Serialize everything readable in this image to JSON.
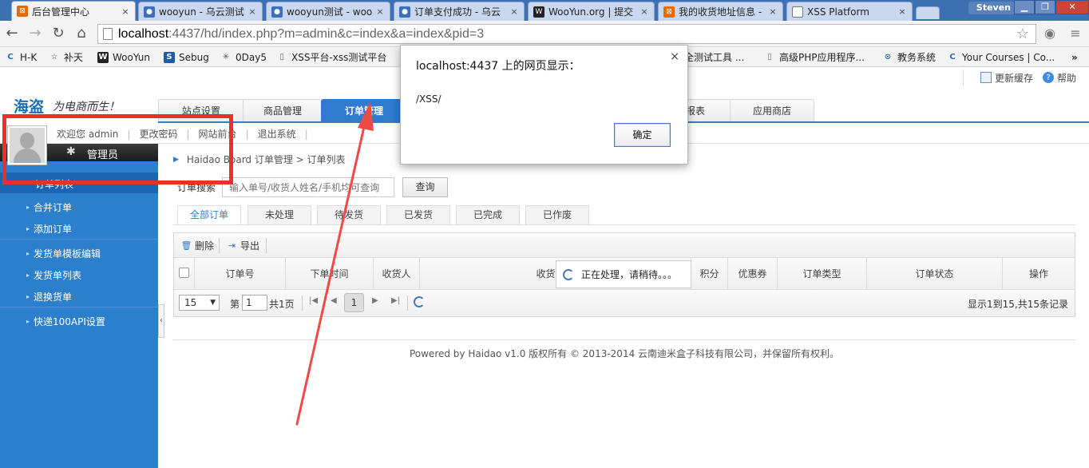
{
  "browser": {
    "tabs": [
      {
        "title": "后台管理中心",
        "close": "×",
        "active": true,
        "favicon_color": "#e36c09"
      },
      {
        "title": "wooyun - 乌云测试",
        "close": "×",
        "active": false,
        "favicon_color": "#3a6fc4"
      },
      {
        "title": "wooyun测试 - woo",
        "close": "×",
        "active": false,
        "favicon_color": "#3a6fc4"
      },
      {
        "title": "订单支付成功 - 乌云",
        "close": "×",
        "active": false,
        "favicon_color": "#3a6fc4"
      },
      {
        "title": "WooYun.org | 提交",
        "close": "×",
        "active": false,
        "favicon_color": "#222222"
      },
      {
        "title": "我的收货地址信息 -",
        "close": "×",
        "active": false,
        "favicon_color": "#e36c09"
      },
      {
        "title": "XSS Platform",
        "close": "×",
        "active": false,
        "favicon_color": "#777777"
      }
    ],
    "profile": "Steven",
    "window_buttons": [
      "▁",
      "❐",
      "✕"
    ],
    "nav": {
      "back": "←",
      "forward": "→",
      "reload": "↻",
      "home": "⌂"
    },
    "url_host": "localhost",
    "url_rest": ":4437/hd/index.php?m=admin&c=index&a=index&pid=3",
    "bookmarks": [
      {
        "label": "H-K",
        "icon": "C",
        "icon_color": "#2b6cc4"
      },
      {
        "label": "补天",
        "icon": "☆",
        "icon_color": "#555555"
      },
      {
        "label": "WooYun",
        "icon": "W",
        "icon_color": "#222222"
      },
      {
        "label": "Sebug",
        "icon": "S",
        "icon_color": "#1e5aa8"
      },
      {
        "label": "0Day5",
        "icon": "✳",
        "icon_color": "#555555"
      },
      {
        "label": "XSS平台-xss测试平台",
        "icon": "▯",
        "icon_color": "#666666"
      },
      {
        "label": "全测试工具 ...",
        "icon": "",
        "icon_color": "#666666"
      },
      {
        "label": "高级PHP应用程序...",
        "icon": "▯",
        "icon_color": "#666666"
      },
      {
        "label": "教务系统",
        "icon": "⊙",
        "icon_color": "#2b6cc4"
      },
      {
        "label": "Your Courses | Co...",
        "icon": "C",
        "icon_color": "#2b6cc4"
      }
    ],
    "more": "»"
  },
  "header": {
    "logo": "海盗",
    "slogan": "为电商而生！",
    "refresh_cache": "更新缓存",
    "help": "帮助",
    "nav": [
      {
        "label": "站点设置",
        "active": false
      },
      {
        "label": "商品管理",
        "active": false
      },
      {
        "label": "订单管理",
        "active": true
      },
      {
        "label": "报表",
        "active": false
      },
      {
        "label": "应用商店",
        "active": false
      }
    ],
    "sublinks": [
      "欢迎您 admin",
      "更改密码",
      "网站前台",
      "退出系统"
    ]
  },
  "sidebar": {
    "role": "管理员",
    "gear": "✱",
    "items": [
      {
        "label": "订单列表",
        "current": true
      },
      {
        "label": "合并订单"
      },
      {
        "label": "添加订单"
      },
      {
        "label": "发货单模板编辑"
      },
      {
        "label": "发货单列表"
      },
      {
        "label": "退换货单"
      },
      {
        "label": "快递100API设置"
      }
    ],
    "collapse": "‹"
  },
  "content": {
    "breadcrumb": "Haidao Board 订单管理 > 订单列表",
    "search_label": "订单搜索",
    "search_placeholder": "输入单号/收货人姓名/手机均可查询",
    "search_button": "查询",
    "status_tabs": [
      "全部订单",
      "未处理",
      "待发货",
      "已发货",
      "已完成",
      "已作废"
    ],
    "toolbar": {
      "delete": "删除",
      "export": "导出"
    },
    "columns": [
      "订单号",
      "下单时间",
      "收货人",
      "收货地址",
      "积分",
      "优惠券",
      "订单类型",
      "订单状态",
      "操作"
    ],
    "loading": "正在处理，请稍待。。。",
    "pager": {
      "page_size": "15",
      "page_prefix": "第",
      "page_value": "1",
      "page_suffix": "共1页",
      "current_page": "1",
      "first": "|◀",
      "prev": "◀",
      "next": "▶",
      "last": "▶|",
      "info": "显示1到15,共15条记录"
    },
    "footer": "Powered by Haidao v1.0 版权所有 © 2013-2014 云南迪米盒子科技有限公司，并保留所有权利。"
  },
  "dialog": {
    "title": "localhost:4437 上的网页显示：",
    "message": "/XSS/",
    "ok": "确定",
    "close": "×"
  },
  "colors": {
    "accent": "#2e7bcf",
    "sidebar": "#2c7fcd",
    "annotation": "#e8312e"
  }
}
